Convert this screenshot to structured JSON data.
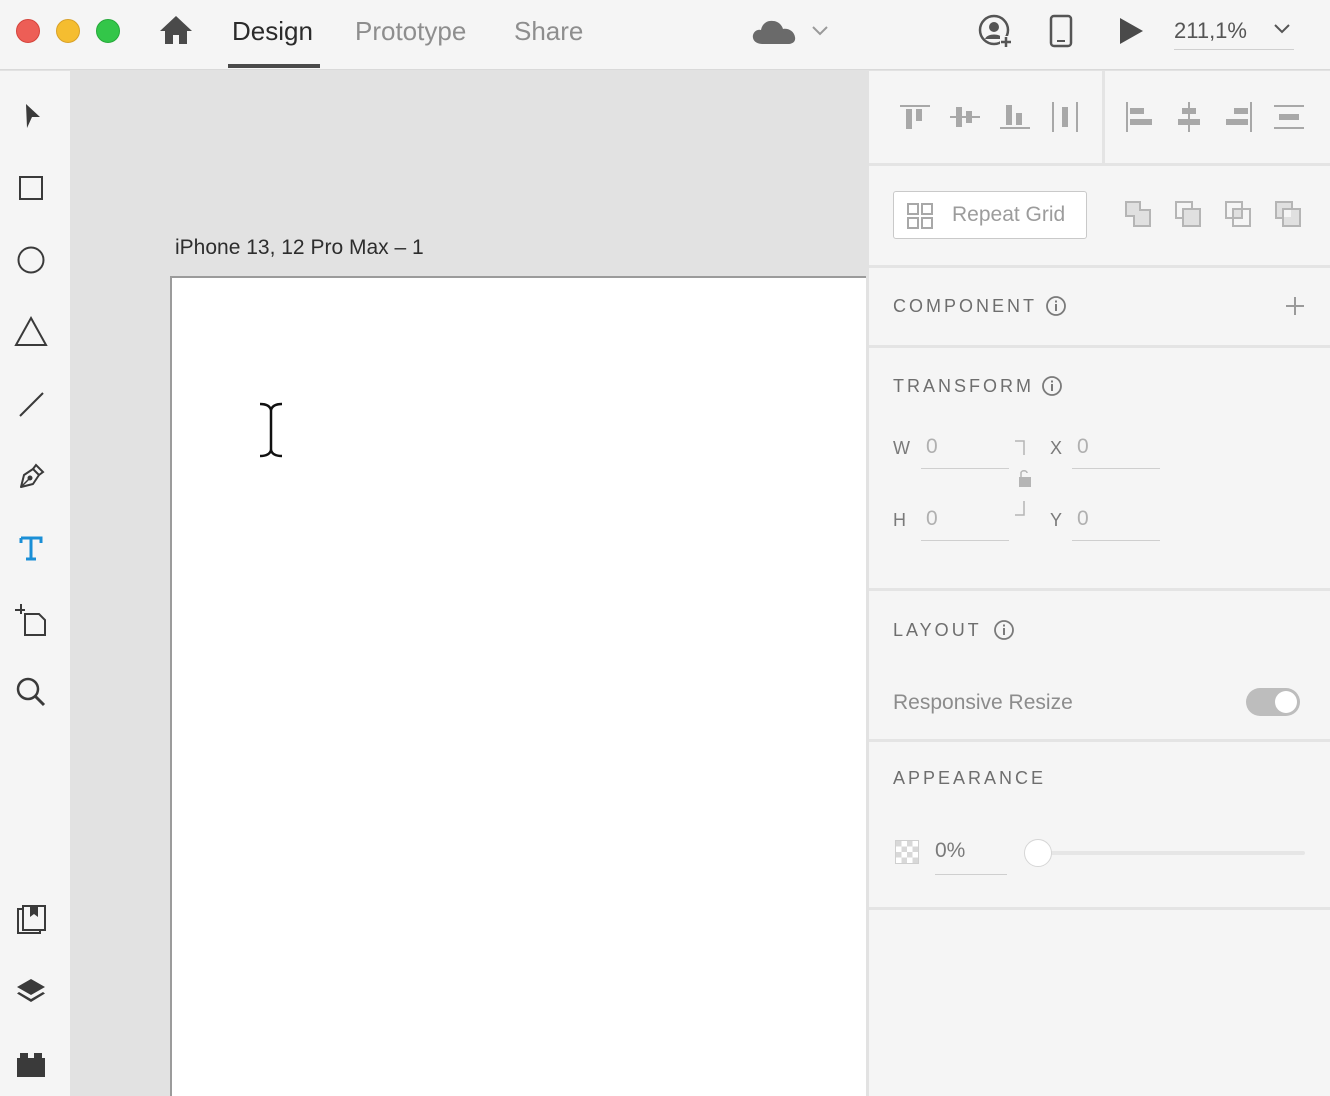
{
  "titlebar": {
    "tabs": [
      {
        "label": "Design",
        "active": true
      },
      {
        "label": "Prototype",
        "active": false
      },
      {
        "label": "Share",
        "active": false
      }
    ],
    "zoom": "211,1%"
  },
  "toolbar": {
    "active_tool": "text",
    "active_color": "#1a8fd6",
    "tools": [
      "select-icon",
      "rectangle-icon",
      "ellipse-icon",
      "polygon-icon",
      "line-icon",
      "pen-icon",
      "text-icon",
      "artboard-icon",
      "zoom-icon",
      "assets-icon",
      "layers-icon",
      "plugins-icon"
    ]
  },
  "canvas": {
    "artboard_label": "iPhone 13, 12 Pro Max – 1"
  },
  "panel": {
    "repeat_grid": "Repeat Grid",
    "component": {
      "title": "COMPONENT"
    },
    "transform": {
      "title": "TRANSFORM",
      "w_label": "W",
      "w_value": "0",
      "h_label": "H",
      "h_value": "0",
      "x_label": "X",
      "x_value": "0",
      "y_label": "Y",
      "y_value": "0"
    },
    "layout": {
      "title": "LAYOUT",
      "responsive_resize": "Responsive Resize",
      "responsive_on": true
    },
    "appearance": {
      "title": "APPEARANCE",
      "opacity": "0%",
      "opacity_fraction": 0
    }
  }
}
